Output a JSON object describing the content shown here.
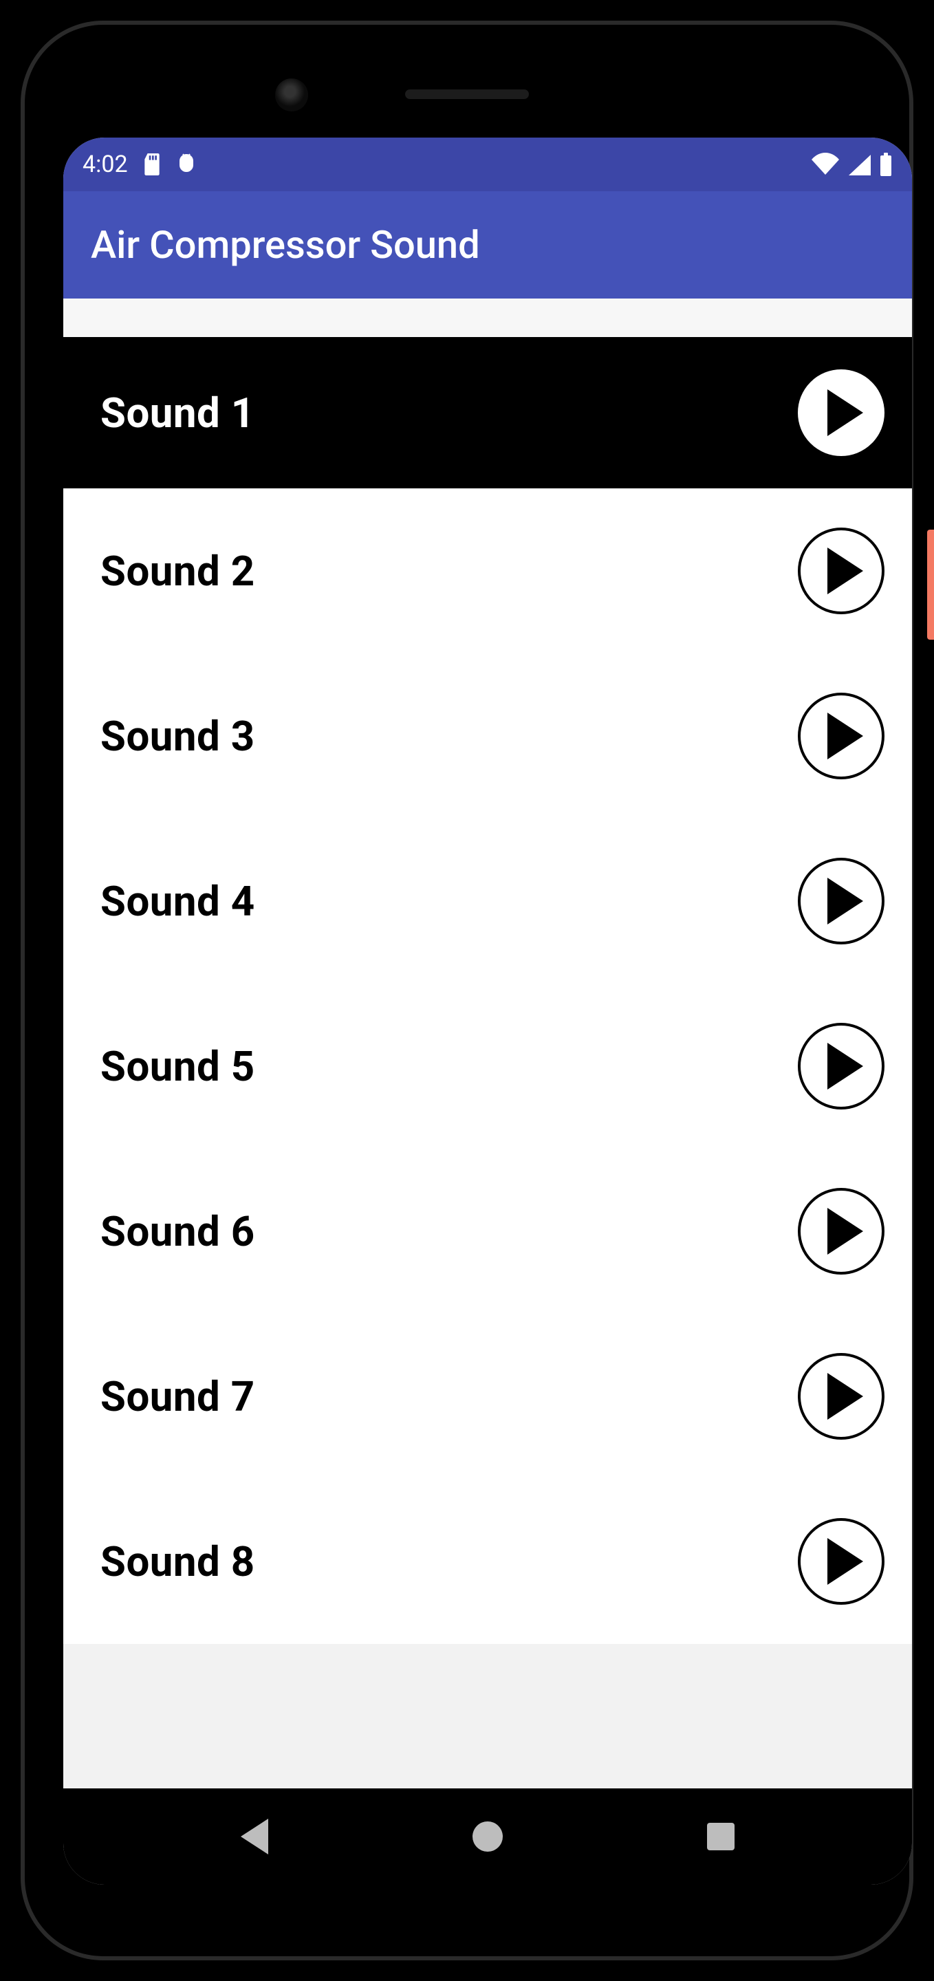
{
  "status": {
    "time": "4:02"
  },
  "appbar": {
    "title": "Air Compressor Sound"
  },
  "sounds": [
    {
      "label": "Sound 1",
      "selected": true
    },
    {
      "label": "Sound 2",
      "selected": false
    },
    {
      "label": "Sound 3",
      "selected": false
    },
    {
      "label": "Sound 4",
      "selected": false
    },
    {
      "label": "Sound 5",
      "selected": false
    },
    {
      "label": "Sound 6",
      "selected": false
    },
    {
      "label": "Sound 7",
      "selected": false
    },
    {
      "label": "Sound 8",
      "selected": false
    }
  ]
}
